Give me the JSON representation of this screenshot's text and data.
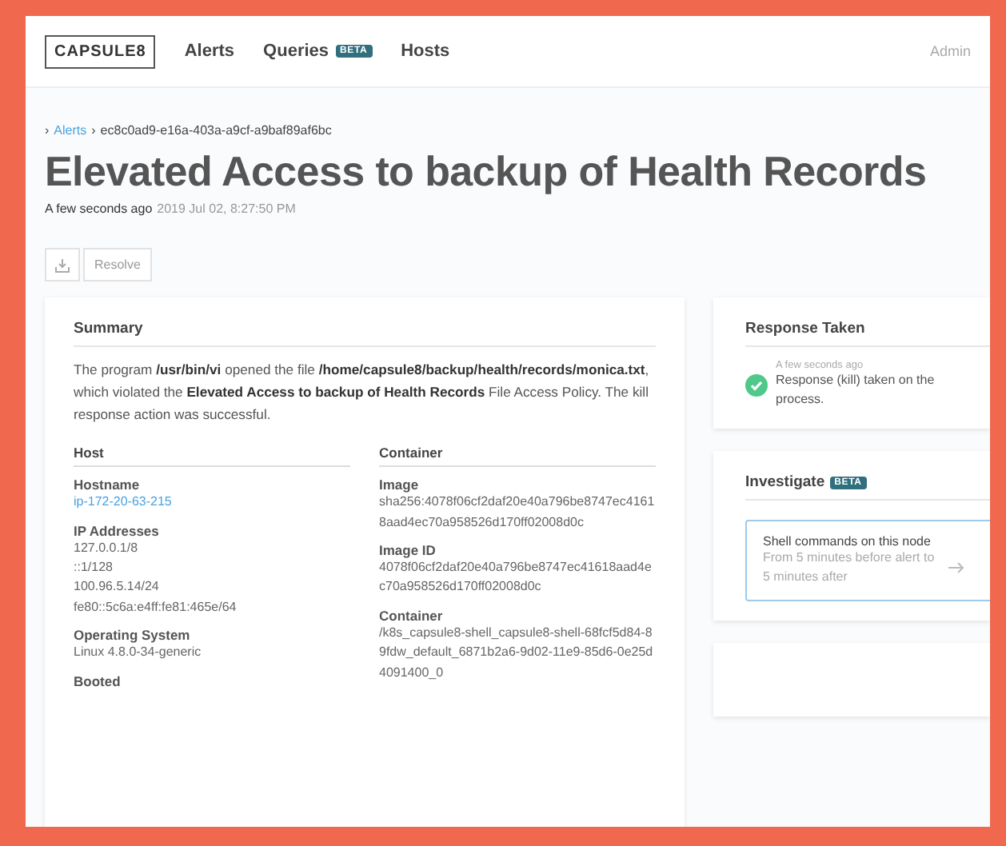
{
  "nav": {
    "logo": "CAPSULE8",
    "items": [
      {
        "label": "Alerts"
      },
      {
        "label": "Queries",
        "badge": "BETA"
      },
      {
        "label": "Hosts"
      }
    ],
    "user": "Admin"
  },
  "breadcrumb": {
    "separator": "›",
    "link": "Alerts",
    "current": "ec8c0ad9-e16a-403a-a9cf-a9baf89af6bc"
  },
  "title": "Elevated Access to backup of Health Records",
  "timestamp": {
    "relative": "A few seconds ago",
    "absolute": "2019 Jul 02, 8:27:50 PM"
  },
  "actions": {
    "resolve": "Resolve"
  },
  "summary": {
    "heading": "Summary",
    "text": "The program **/usr/bin/vi** opened the file **/home/capsule8/backup/health/records/monica.txt**, which violated the **Elevated Access to backup of Health Records** File Access Policy. The kill response action was successful.",
    "columns": [
      {
        "heading": "Host",
        "fields": [
          {
            "label": "Hostname",
            "values": [
              "ip-172-20-63-215"
            ],
            "kind": "link"
          },
          {
            "label": "IP Addresses",
            "values": [
              "127.0.0.1/8",
              "::1/128",
              "100.96.5.14/24",
              "fe80::5c6a:e4ff:fe81:465e/64"
            ],
            "kind": "text"
          },
          {
            "label": "Operating System",
            "values": [
              "Linux 4.8.0-34-generic"
            ],
            "kind": "text"
          },
          {
            "label": "Booted"
          }
        ]
      },
      {
        "heading": "Container",
        "fields": [
          {
            "label": "Image",
            "values": [
              "sha256:4078f06cf2daf20e40a796be8747ec41618aad4ec70a958526d170ff02008d0c"
            ],
            "kind": "text"
          },
          {
            "label": "Image ID",
            "values": [
              "4078f06cf2daf20e40a796be8747ec41618aad4ec70a958526d170ff02008d0c"
            ],
            "kind": "text"
          },
          {
            "label": "Container",
            "values": [
              "/k8s_capsule8-shell_capsule8-shell-68fcf5d84-89fdw_default_6871b2a6-9d02-11e9-85d6-0e25d4091400_0"
            ],
            "kind": "text"
          }
        ]
      }
    ]
  },
  "response": {
    "heading": "Response Taken",
    "time": "A few seconds ago",
    "text": "Response (kill) taken on the process."
  },
  "investigate": {
    "heading": "Investigate",
    "badge": "BETA",
    "query": {
      "title": "Shell commands on this node",
      "detail": "From 5 minutes before alert to 5 minutes after"
    }
  }
}
